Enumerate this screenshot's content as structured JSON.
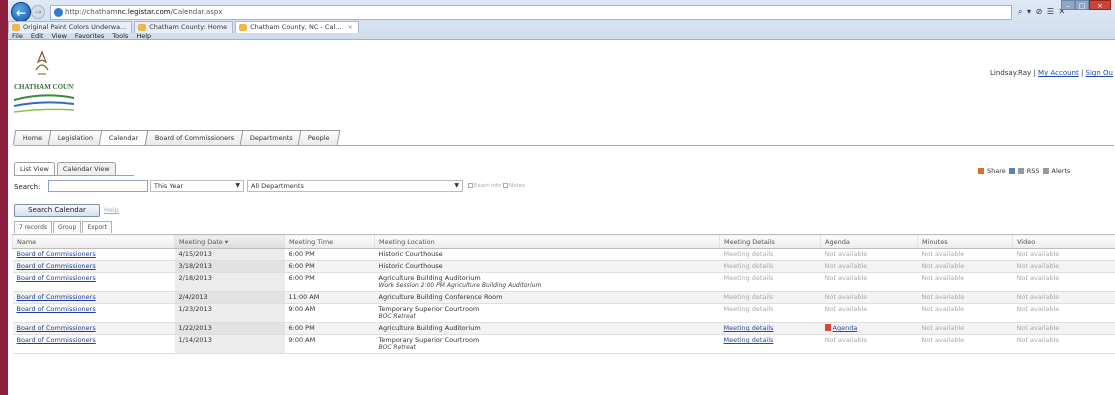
{
  "browser": {
    "url_prefix": "http://",
    "url_domain": "chatham",
    "url_host": "nc.legistar.com",
    "url_path": "/Calendar.aspx",
    "address_tools": "⌕ ▾ ⊘ ☰ ✕",
    "tabs": [
      {
        "label": "Original Paint Colors Underwa...",
        "close": ""
      },
      {
        "label": "Chatham County: Home",
        "close": ""
      },
      {
        "label": "Chatham County, NC - Cal...",
        "close": "×"
      }
    ],
    "menu": [
      "File",
      "Edit",
      "View",
      "Favorites",
      "Tools",
      "Help"
    ]
  },
  "logo": {
    "text": "CHATHAM COUNTY"
  },
  "user": {
    "name": "Lindsay.Ray",
    "sep1": "|",
    "account": "My Account",
    "sep2": "|",
    "signout": "Sign Ou"
  },
  "main_tabs": [
    "Home",
    "Legislation",
    "Calendar",
    "Board of Commissioners",
    "Departments",
    "People"
  ],
  "share": {
    "share": "Share",
    "rss": "RSS",
    "alerts": "Alerts"
  },
  "view_tabs": [
    "List View",
    "Calendar View"
  ],
  "search": {
    "label": "Search:",
    "value": "",
    "year": "This Year",
    "department": "All Departments",
    "check1": "Exact info",
    "check2": "Notes",
    "button": "Search Calendar",
    "help": "Help"
  },
  "grid_tabs": [
    "7 records",
    "Group",
    "Export"
  ],
  "columns": [
    "Name",
    "Meeting Date",
    "Meeting Time",
    "Meeting Location",
    "Meeting Details",
    "Agenda",
    "Minutes",
    "Video"
  ],
  "sort_indicator": "▾",
  "rows": [
    {
      "name": "Board of Commissioners",
      "date": "4/15/2013",
      "time": "6:00 PM",
      "location": "Historic Courthouse",
      "sub": "",
      "details": "Meeting details",
      "agenda": "Not available",
      "minutes": "Not available",
      "video": "Not available"
    },
    {
      "name": "Board of Commissioners",
      "date": "3/18/2013",
      "time": "6:00 PM",
      "location": "Historic Courthouse",
      "sub": "",
      "details": "Meeting details",
      "agenda": "Not available",
      "minutes": "Not available",
      "video": "Not available"
    },
    {
      "name": "Board of Commissioners",
      "date": "2/18/2013",
      "time": "6:00 PM",
      "location": "Agriculture Building Auditorium",
      "sub": "Work Session 2:00 PM Agriculture Building Auditorium",
      "details": "Meeting details",
      "agenda": "Not available",
      "minutes": "Not available",
      "video": "Not available"
    },
    {
      "name": "Board of Commissioners",
      "date": "2/4/2013",
      "time": "11:00 AM",
      "location": "Agriculture Building Conference Room",
      "sub": "",
      "details": "Meeting details",
      "agenda": "Not available",
      "minutes": "Not available",
      "video": "Not available"
    },
    {
      "name": "Board of Commissioners",
      "date": "1/23/2013",
      "time": "9:00 AM",
      "location": "Temporary Superior Courtroom",
      "sub": "BOC Retreat",
      "details": "Meeting details",
      "agenda": "Not available",
      "minutes": "Not available",
      "video": "Not available"
    },
    {
      "name": "Board of Commissioners",
      "date": "1/22/2013",
      "time": "6:00 PM",
      "location": "Agriculture Building Auditorium",
      "sub": "",
      "details": "Meeting details",
      "agenda": "Agenda",
      "minutes": "Not available",
      "video": "Not available"
    },
    {
      "name": "Board of Commissioners",
      "date": "1/14/2013",
      "time": "9:00 AM",
      "location": "Temporary Superior Courtroom",
      "sub": "BOC Retreat",
      "details": "Meeting details",
      "agenda": "Not available",
      "minutes": "Not available",
      "video": "Not available"
    }
  ]
}
